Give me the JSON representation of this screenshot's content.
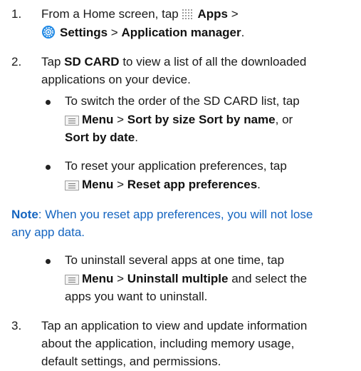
{
  "steps": {
    "s1": {
      "num": "1.",
      "l1_pre": "From a Home screen, tap ",
      "apps": "Apps",
      "gt": ">",
      "settings": "Settings",
      "appmgr": "Application manager",
      "end": "."
    },
    "s2": {
      "num": "2.",
      "l1_pre": "Tap ",
      "sdcard": "SD CARD",
      "l1_post": " to view a list of all the downloaded",
      "l2": "applications on your device."
    },
    "b1": {
      "l1": "To switch the order of the SD CARD list, tap",
      "menu": "Menu",
      "gt": ">",
      "sortsize": "Sort by size Sort by name",
      "or": ", or",
      "sortdate": "Sort by date",
      "end": "."
    },
    "b2": {
      "l1": "To reset your application preferences, tap",
      "menu": "Menu",
      "gt": ">",
      "reset": "Reset app preferences",
      "end": "."
    },
    "note": {
      "label": "Note",
      "l1": ": When you reset app preferences, you will not lose",
      "l2": "any app data."
    },
    "b3": {
      "l1": "To uninstall several apps at one time, tap",
      "menu": "Menu",
      "gt": ">",
      "uninstall": "Uninstall multiple",
      "l2_post": " and select the",
      "l3": "apps you want to uninstall."
    },
    "s3": {
      "num": "3.",
      "l1": "Tap an application to view and update information",
      "l2": "about the application, including memory usage,",
      "l3": "default settings, and permissions."
    }
  },
  "icons": {
    "apps": "apps-grid-icon",
    "settings": "settings-gear-icon",
    "menu": "menu-icon",
    "settings_color": "#1e88e5"
  }
}
